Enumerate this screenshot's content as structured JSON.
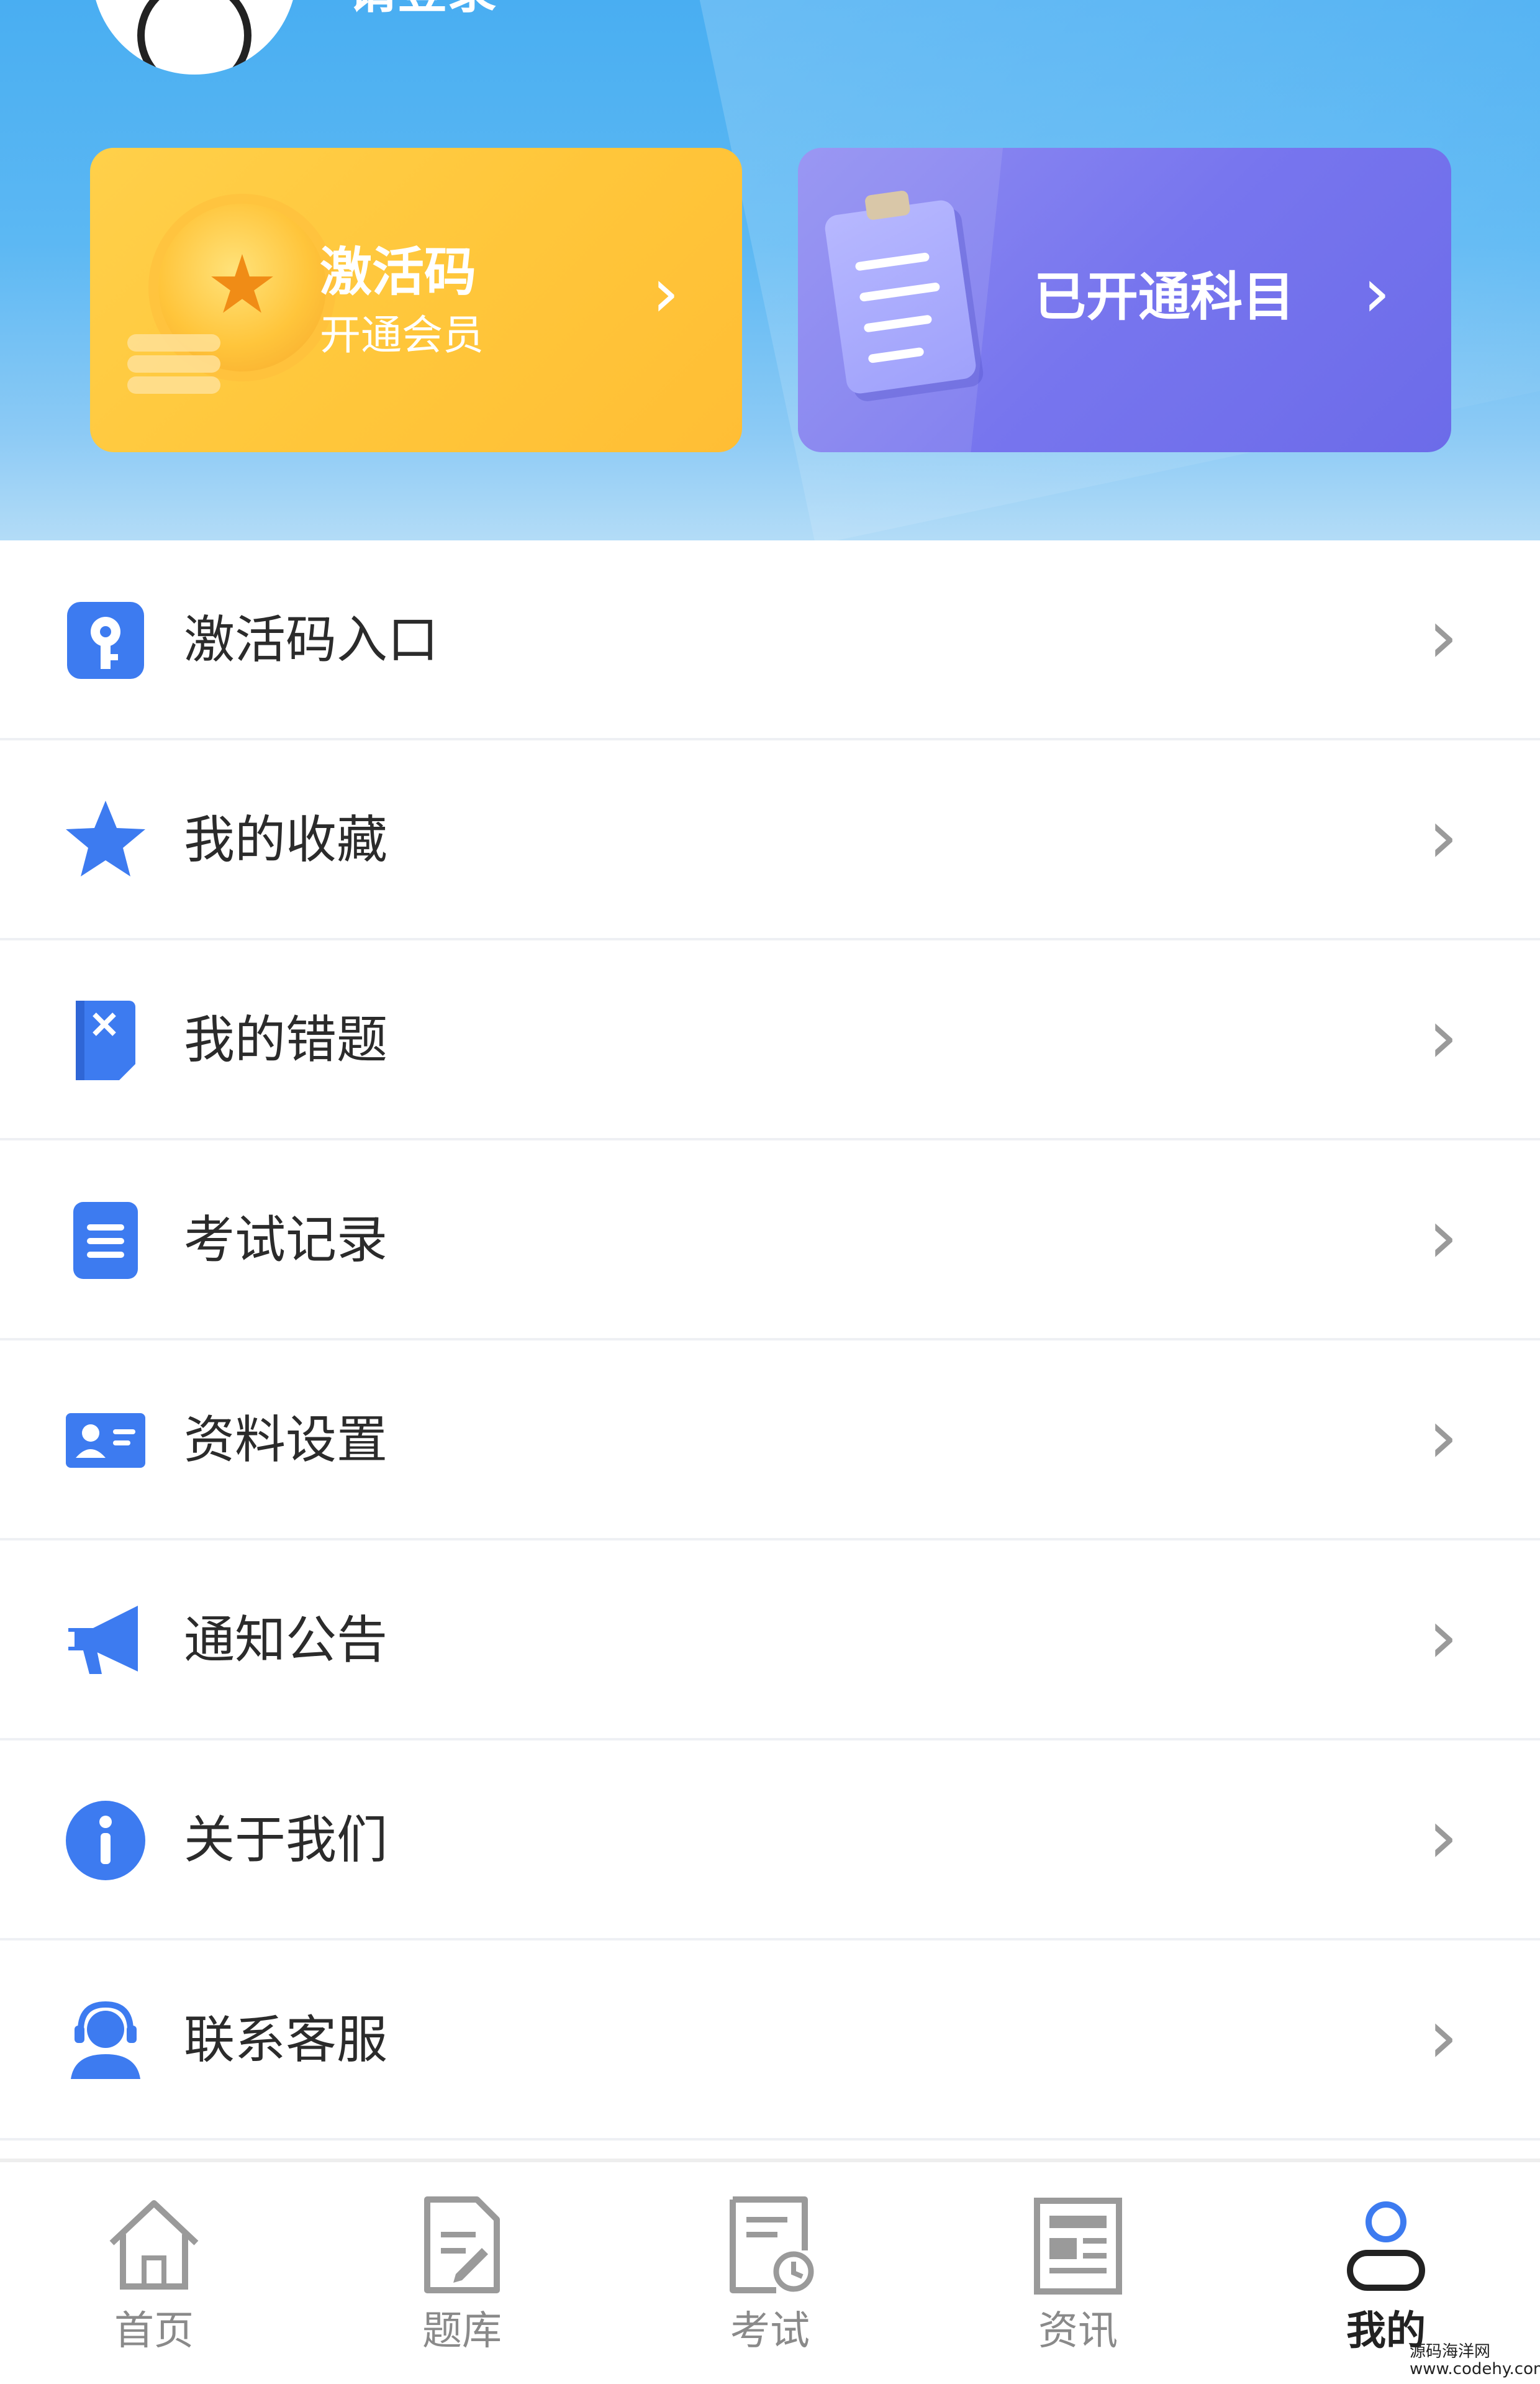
{
  "header": {
    "login_text": "请登录"
  },
  "cards": {
    "vip": {
      "title": "激活码",
      "subtitle": "开通会员",
      "chevron": "›",
      "icon": "coin-star-icon"
    },
    "subjects": {
      "title": "已开通科目",
      "chevron": "›",
      "icon": "clipboard-icon"
    }
  },
  "menu": {
    "items": [
      {
        "label": "激活码入口",
        "icon": "key-icon"
      },
      {
        "label": "我的收藏",
        "icon": "star-icon"
      },
      {
        "label": "我的错题",
        "icon": "wrong-book-icon"
      },
      {
        "label": "考试记录",
        "icon": "record-icon"
      },
      {
        "label": "资料设置",
        "icon": "profile-card-icon"
      },
      {
        "label": "通知公告",
        "icon": "megaphone-icon"
      },
      {
        "label": "关于我们",
        "icon": "info-icon"
      },
      {
        "label": "联系客服",
        "icon": "customer-service-icon"
      }
    ],
    "chevron": "›"
  },
  "tabbar": {
    "tabs": [
      {
        "label": "首页",
        "icon": "home-icon"
      },
      {
        "label": "题库",
        "icon": "question-bank-icon"
      },
      {
        "label": "考试",
        "icon": "exam-icon"
      },
      {
        "label": "资讯",
        "icon": "news-icon"
      },
      {
        "label": "我的",
        "icon": "user-icon",
        "active": true
      }
    ]
  },
  "watermark": {
    "line1": "源码海洋网",
    "line2": "www.codehy.com"
  },
  "colors": {
    "accent": "#3d7bf0",
    "vip_card": "#ffc63a",
    "subject_card": "#7775ee",
    "header_top": "#49aef2"
  }
}
